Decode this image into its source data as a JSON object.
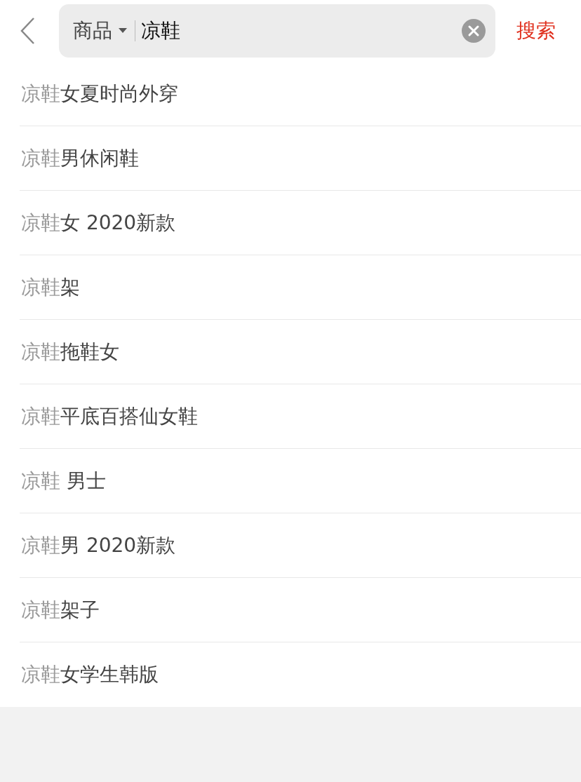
{
  "header": {
    "category": "商品",
    "query": "凉鞋",
    "search_button": "搜索"
  },
  "suggestions": [
    {
      "match": "凉鞋",
      "rest": "女夏时尚外穿"
    },
    {
      "match": "凉鞋",
      "rest": "男休闲鞋"
    },
    {
      "match": "凉鞋",
      "rest": "女 2020新款"
    },
    {
      "match": "凉鞋",
      "rest": "架"
    },
    {
      "match": "凉鞋",
      "rest": "拖鞋女"
    },
    {
      "match": "凉鞋",
      "rest": "平底百搭仙女鞋"
    },
    {
      "match": "凉鞋",
      "rest": " 男士"
    },
    {
      "match": "凉鞋",
      "rest": "男 2020新款"
    },
    {
      "match": "凉鞋",
      "rest": "架子"
    },
    {
      "match": "凉鞋",
      "rest": "女学生韩版"
    }
  ]
}
